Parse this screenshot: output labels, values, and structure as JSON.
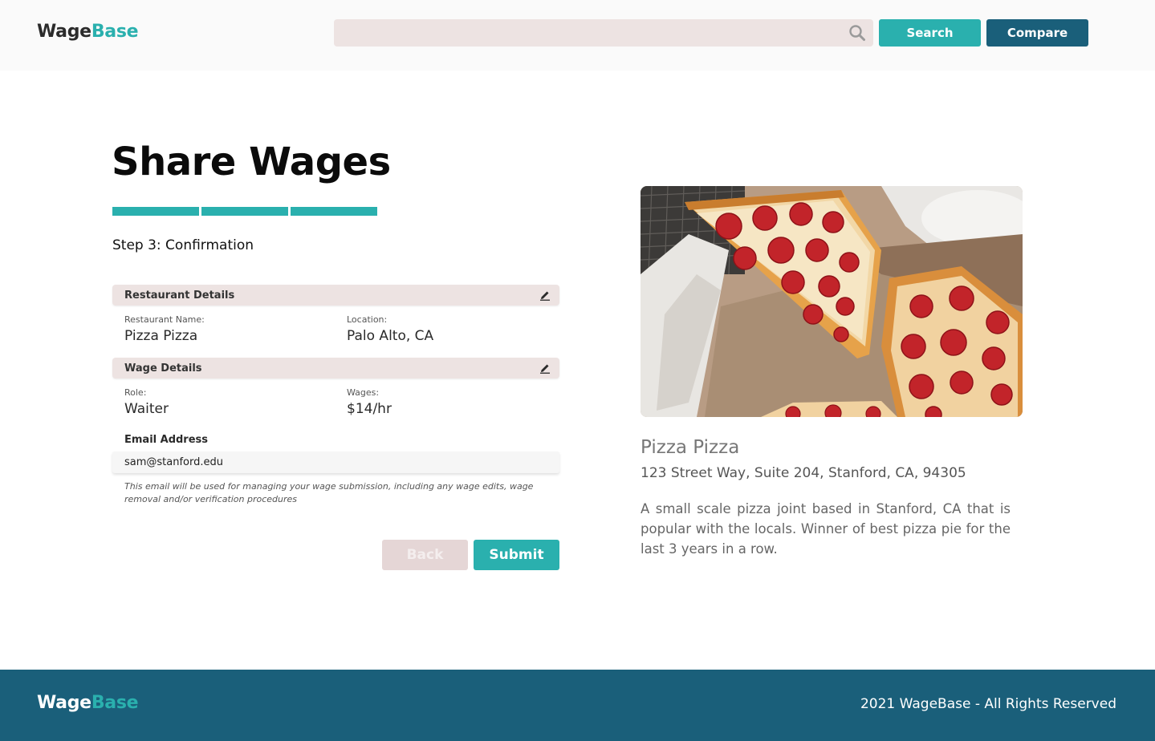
{
  "header": {
    "logo_part1": "Wage",
    "logo_part2": "Base",
    "search_value": "",
    "search_label": "Search",
    "compare_label": "Compare"
  },
  "form": {
    "title": "Share Wages",
    "progress": {
      "completed_steps": 3,
      "total_steps": 3
    },
    "step_label": "Step 3: Confirmation",
    "restaurant_section": {
      "title": "Restaurant Details",
      "name_label": "Restaurant Name:",
      "name_value": "Pizza Pizza",
      "location_label": "Location:",
      "location_value": "Palo Alto, CA"
    },
    "wage_section": {
      "title": "Wage Details",
      "role_label": "Role:",
      "role_value": "Waiter",
      "wages_label": "Wages:",
      "wages_value": "$14/hr"
    },
    "email": {
      "label": "Email Address",
      "value": "sam@stanford.edu",
      "note": "This email will be used for managing your wage submission, including any wage edits, wage removal and/or verification procedures"
    },
    "back_label": "Back",
    "submit_label": "Submit"
  },
  "restaurant": {
    "name": "Pizza Pizza",
    "address": "123 Street Way,  Suite 204, Stanford, CA, 94305",
    "description": "A small scale pizza joint based in Stanford, CA that is popular with the locals. Winner of best pizza pie for the last 3 years in a row."
  },
  "footer": {
    "logo_part1": "Wage",
    "logo_part2": "Base",
    "copyright": "2021 WageBase - All Rights Reserved"
  },
  "colors": {
    "accent": "#2ab0ae",
    "primary_dark": "#1a5f7a",
    "section_bg": "#ede3e2"
  }
}
